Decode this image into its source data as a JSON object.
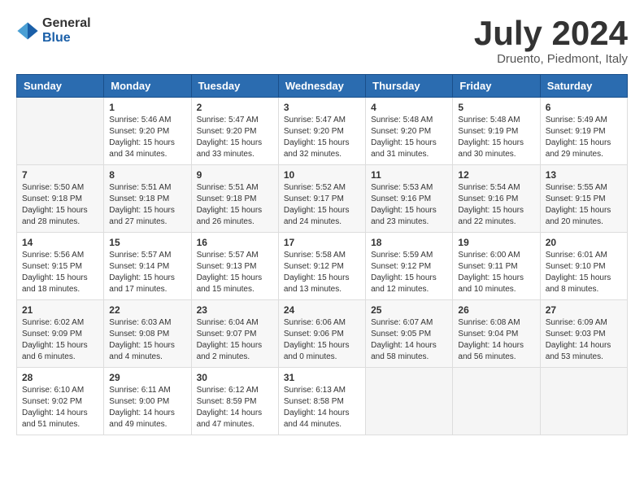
{
  "header": {
    "logo_general": "General",
    "logo_blue": "Blue",
    "title": "July 2024",
    "location": "Druento, Piedmont, Italy"
  },
  "calendar": {
    "days_of_week": [
      "Sunday",
      "Monday",
      "Tuesday",
      "Wednesday",
      "Thursday",
      "Friday",
      "Saturday"
    ],
    "weeks": [
      [
        {
          "day": "",
          "content": ""
        },
        {
          "day": "1",
          "content": "Sunrise: 5:46 AM\nSunset: 9:20 PM\nDaylight: 15 hours\nand 34 minutes."
        },
        {
          "day": "2",
          "content": "Sunrise: 5:47 AM\nSunset: 9:20 PM\nDaylight: 15 hours\nand 33 minutes."
        },
        {
          "day": "3",
          "content": "Sunrise: 5:47 AM\nSunset: 9:20 PM\nDaylight: 15 hours\nand 32 minutes."
        },
        {
          "day": "4",
          "content": "Sunrise: 5:48 AM\nSunset: 9:20 PM\nDaylight: 15 hours\nand 31 minutes."
        },
        {
          "day": "5",
          "content": "Sunrise: 5:48 AM\nSunset: 9:19 PM\nDaylight: 15 hours\nand 30 minutes."
        },
        {
          "day": "6",
          "content": "Sunrise: 5:49 AM\nSunset: 9:19 PM\nDaylight: 15 hours\nand 29 minutes."
        }
      ],
      [
        {
          "day": "7",
          "content": "Sunrise: 5:50 AM\nSunset: 9:18 PM\nDaylight: 15 hours\nand 28 minutes."
        },
        {
          "day": "8",
          "content": "Sunrise: 5:51 AM\nSunset: 9:18 PM\nDaylight: 15 hours\nand 27 minutes."
        },
        {
          "day": "9",
          "content": "Sunrise: 5:51 AM\nSunset: 9:18 PM\nDaylight: 15 hours\nand 26 minutes."
        },
        {
          "day": "10",
          "content": "Sunrise: 5:52 AM\nSunset: 9:17 PM\nDaylight: 15 hours\nand 24 minutes."
        },
        {
          "day": "11",
          "content": "Sunrise: 5:53 AM\nSunset: 9:16 PM\nDaylight: 15 hours\nand 23 minutes."
        },
        {
          "day": "12",
          "content": "Sunrise: 5:54 AM\nSunset: 9:16 PM\nDaylight: 15 hours\nand 22 minutes."
        },
        {
          "day": "13",
          "content": "Sunrise: 5:55 AM\nSunset: 9:15 PM\nDaylight: 15 hours\nand 20 minutes."
        }
      ],
      [
        {
          "day": "14",
          "content": "Sunrise: 5:56 AM\nSunset: 9:15 PM\nDaylight: 15 hours\nand 18 minutes."
        },
        {
          "day": "15",
          "content": "Sunrise: 5:57 AM\nSunset: 9:14 PM\nDaylight: 15 hours\nand 17 minutes."
        },
        {
          "day": "16",
          "content": "Sunrise: 5:57 AM\nSunset: 9:13 PM\nDaylight: 15 hours\nand 15 minutes."
        },
        {
          "day": "17",
          "content": "Sunrise: 5:58 AM\nSunset: 9:12 PM\nDaylight: 15 hours\nand 13 minutes."
        },
        {
          "day": "18",
          "content": "Sunrise: 5:59 AM\nSunset: 9:12 PM\nDaylight: 15 hours\nand 12 minutes."
        },
        {
          "day": "19",
          "content": "Sunrise: 6:00 AM\nSunset: 9:11 PM\nDaylight: 15 hours\nand 10 minutes."
        },
        {
          "day": "20",
          "content": "Sunrise: 6:01 AM\nSunset: 9:10 PM\nDaylight: 15 hours\nand 8 minutes."
        }
      ],
      [
        {
          "day": "21",
          "content": "Sunrise: 6:02 AM\nSunset: 9:09 PM\nDaylight: 15 hours\nand 6 minutes."
        },
        {
          "day": "22",
          "content": "Sunrise: 6:03 AM\nSunset: 9:08 PM\nDaylight: 15 hours\nand 4 minutes."
        },
        {
          "day": "23",
          "content": "Sunrise: 6:04 AM\nSunset: 9:07 PM\nDaylight: 15 hours\nand 2 minutes."
        },
        {
          "day": "24",
          "content": "Sunrise: 6:06 AM\nSunset: 9:06 PM\nDaylight: 15 hours\nand 0 minutes."
        },
        {
          "day": "25",
          "content": "Sunrise: 6:07 AM\nSunset: 9:05 PM\nDaylight: 14 hours\nand 58 minutes."
        },
        {
          "day": "26",
          "content": "Sunrise: 6:08 AM\nSunset: 9:04 PM\nDaylight: 14 hours\nand 56 minutes."
        },
        {
          "day": "27",
          "content": "Sunrise: 6:09 AM\nSunset: 9:03 PM\nDaylight: 14 hours\nand 53 minutes."
        }
      ],
      [
        {
          "day": "28",
          "content": "Sunrise: 6:10 AM\nSunset: 9:02 PM\nDaylight: 14 hours\nand 51 minutes."
        },
        {
          "day": "29",
          "content": "Sunrise: 6:11 AM\nSunset: 9:00 PM\nDaylight: 14 hours\nand 49 minutes."
        },
        {
          "day": "30",
          "content": "Sunrise: 6:12 AM\nSunset: 8:59 PM\nDaylight: 14 hours\nand 47 minutes."
        },
        {
          "day": "31",
          "content": "Sunrise: 6:13 AM\nSunset: 8:58 PM\nDaylight: 14 hours\nand 44 minutes."
        },
        {
          "day": "",
          "content": ""
        },
        {
          "day": "",
          "content": ""
        },
        {
          "day": "",
          "content": ""
        }
      ]
    ]
  }
}
